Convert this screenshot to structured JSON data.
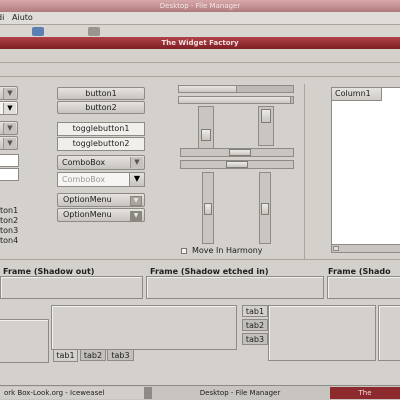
{
  "file_manager": {
    "title": "Desktop - File Manager",
    "menus": [
      "di",
      "Aiuto"
    ]
  },
  "widget_factory": {
    "title": "The Widget Factory",
    "buttons": [
      "button1",
      "button2"
    ],
    "toggle_buttons": [
      "togglebutton1",
      "togglebutton2"
    ],
    "combo_box": "ComboBox",
    "combo_box_disabled": "ComboBox",
    "option_menus": [
      "OptionMenu",
      "OptionMenu"
    ],
    "radio_labels": [
      "ton1",
      "ton2",
      "ton3",
      "ton4"
    ],
    "move_in_harmony": "Move In Harmony",
    "tree_column": "Column1",
    "frames": [
      "Frame (Shadow out)",
      "Frame (Shadow etched in)",
      "Frame (Shado"
    ],
    "tabs_bottom": [
      "tab1",
      "tab2",
      "tab3"
    ],
    "tabs_side": [
      "tab1",
      "tab2",
      "tab3"
    ],
    "colors": {
      "title_active": "#8c2a2e",
      "title_inactive": "#b98385",
      "bg": "#d4d0cc"
    },
    "sliders": {
      "h_scale_1": 0.5,
      "h_scale_2": 0.97,
      "v_scale_1": 0.35,
      "v_scale_2": 0.35,
      "h_scale_3": 0.5,
      "h_scale_4": 0.45,
      "v_scale_3": 0.5,
      "v_scale_4": 0.5
    }
  },
  "taskbar": {
    "items": [
      "ork Box-Look.org - Iceweasel",
      "Desktop - File Manager",
      "The"
    ]
  }
}
